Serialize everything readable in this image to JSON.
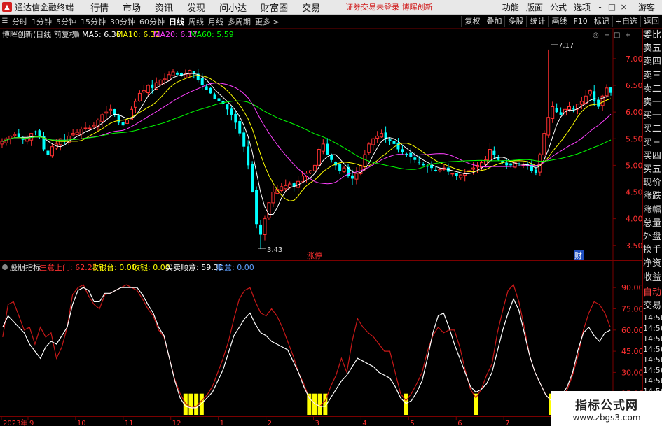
{
  "titlebar": {
    "app_name": "通达信金融终端",
    "logo_glyph": "▲",
    "menus": [
      "行情",
      "市场",
      "资讯",
      "发现",
      "问小达",
      "财富圈",
      "交易"
    ],
    "promo": "证券交易未登录  博晖创新",
    "right_menus": [
      "功能",
      "版面",
      "公式",
      "选项"
    ],
    "login": "游客",
    "window_buttons": [
      "-",
      "□",
      "×"
    ]
  },
  "toolbar": {
    "periods": [
      "分时",
      "1分钟",
      "5分钟",
      "15分钟",
      "30分钟",
      "60分钟",
      "日线",
      "周线",
      "月线",
      "多周期",
      "更多 >"
    ],
    "active_period": "日线",
    "buttons": [
      "复权",
      "叠加",
      "多股",
      "统计",
      "画线",
      "F10",
      "标记",
      "+自选",
      "返回"
    ]
  },
  "main_chart": {
    "header_title": "博晖创新(日线 前复权)",
    "ma_labels": [
      {
        "text": "MA5: 6.36",
        "color": "#ffffff"
      },
      {
        "text": "MA10: 6.31",
        "color": "#ffff00"
      },
      {
        "text": "MA20: 6.17",
        "color": "#ff40ff"
      },
      {
        "text": "MA60: 5.59",
        "color": "#00ff00"
      }
    ],
    "y_ticks": [
      "7.00",
      "6.50",
      "6.00",
      "5.50",
      "5.00",
      "4.50",
      "4.00",
      "3.50"
    ],
    "high_label": "7.17",
    "low_label": "3.43",
    "tag_zhangting": "涨停",
    "tag_cai": "财",
    "colors": {
      "up": "#ff3030",
      "down": "#00ffff",
      "ma5": "#ffffff",
      "ma10": "#ffff00",
      "ma20": "#ff40ff",
      "ma60": "#00ff00"
    }
  },
  "indicator": {
    "name": "股朋指标",
    "values": [
      {
        "text": "生意上门: 62.21",
        "color": "#ff3030"
      },
      {
        "text": "收银台: 0.00",
        "color": "#ffff00"
      },
      {
        "text": "收银: 0.00",
        "color": "#ffff00"
      },
      {
        "text": "买卖顺意: 59.31",
        "color": "#ffffff"
      },
      {
        "text": "顺意: 0.00",
        "color": "#5fa0ff"
      }
    ],
    "y_ticks": [
      "90.00",
      "75.00",
      "60.00",
      "45.00",
      "30.00",
      "15.00"
    ]
  },
  "date_axis": [
    "2023年",
    "9",
    "10",
    "11",
    "12",
    "1",
    "2",
    "3",
    "4",
    "5",
    "6",
    "7",
    "8",
    "9"
  ],
  "right_panel": {
    "items": [
      "委比",
      "卖五",
      "卖四",
      "卖三",
      "卖二",
      "卖一",
      "买一",
      "买二",
      "买三",
      "买四",
      "买五",
      "现价",
      "涨跌",
      "涨幅",
      "总量",
      "外盘",
      "换手",
      "净资",
      "收益"
    ],
    "label_auto": "自动",
    "label_trade": "交易",
    "times": [
      "14:56",
      "14:56",
      "14:56",
      "14:56",
      "14:56",
      "14:56",
      "14:56",
      "14:56",
      "14:56",
      "14:56"
    ]
  },
  "watermark": {
    "line1": "指标公式网",
    "line2": "www.zbgs3.com"
  },
  "chart_data": [
    {
      "type": "candlestick",
      "title": "博晖创新(日线 前复权)",
      "ylim": [
        3.3,
        7.3
      ],
      "closes": [
        5.45,
        5.5,
        5.55,
        5.58,
        5.52,
        5.48,
        5.5,
        5.6,
        5.62,
        5.55,
        5.3,
        5.2,
        5.35,
        5.4,
        5.5,
        5.45,
        5.55,
        5.6,
        5.62,
        5.68,
        5.7,
        5.7,
        5.75,
        5.85,
        5.95,
        6.0,
        6.05,
        5.95,
        5.8,
        5.75,
        5.85,
        6.05,
        6.2,
        6.35,
        6.4,
        6.5,
        6.45,
        6.55,
        6.6,
        6.62,
        6.7,
        6.75,
        6.7,
        6.68,
        6.72,
        6.78,
        6.72,
        6.6,
        6.5,
        6.42,
        6.35,
        6.25,
        6.2,
        6.15,
        6.05,
        5.95,
        5.8,
        5.6,
        5.35,
        5.0,
        4.5,
        3.9,
        3.7,
        4.0,
        4.3,
        4.5,
        4.55,
        4.6,
        4.62,
        4.65,
        4.6,
        4.7,
        4.8,
        4.85,
        4.9,
        5.0,
        5.3,
        5.4,
        5.2,
        5.1,
        5.0,
        4.9,
        4.95,
        4.8,
        4.75,
        4.85,
        5.0,
        5.2,
        5.4,
        5.5,
        5.55,
        5.6,
        5.5,
        5.45,
        5.4,
        5.3,
        5.25,
        5.2,
        5.15,
        5.1,
        5.05,
        5.0,
        4.98,
        4.95,
        4.9,
        4.92,
        4.95,
        4.88,
        4.85,
        4.8,
        4.82,
        4.85,
        4.9,
        4.95,
        5.0,
        5.05,
        5.1,
        5.3,
        5.2,
        5.1,
        5.05,
        5.0,
        5.0,
        5.05,
        5.02,
        5.0,
        4.98,
        4.9,
        4.85,
        5.2,
        5.6,
        5.9,
        6.1,
        6.0,
        5.95,
        6.05,
        6.1,
        6.05,
        6.15,
        6.2,
        6.3,
        6.4,
        6.2,
        6.1,
        6.3,
        6.45,
        6.36
      ],
      "ma_last": {
        "MA5": 6.36,
        "MA10": 6.31,
        "MA20": 6.17,
        "MA60": 5.59
      },
      "high": 7.17,
      "low": 3.43
    },
    {
      "type": "line",
      "title": "股朋指标",
      "ylim": [
        0,
        100
      ],
      "series": [
        {
          "name": "生意上门",
          "values": [
            55,
            78,
            80,
            70,
            60,
            62,
            50,
            62,
            55,
            58,
            40,
            48,
            62,
            85,
            90,
            92,
            84,
            78,
            75,
            85,
            86,
            88,
            90,
            92,
            90,
            88,
            82,
            75,
            70,
            60,
            55,
            40,
            25,
            15,
            8,
            5,
            6,
            10,
            14,
            20,
            30,
            40,
            52,
            68,
            82,
            88,
            90,
            80,
            72,
            70,
            75,
            70,
            62,
            52,
            42,
            30,
            22,
            12,
            8,
            6,
            10,
            20,
            28,
            40,
            30,
            52,
            68,
            62,
            58,
            55,
            50,
            45,
            45,
            30,
            15,
            10,
            15,
            22,
            30,
            45,
            56,
            62,
            58,
            60,
            60,
            48,
            32,
            18,
            12,
            18,
            28,
            36,
            58,
            74,
            88,
            92,
            80,
            62,
            42,
            30,
            22,
            14,
            10,
            8,
            12,
            18,
            28,
            42,
            60,
            72,
            80,
            78,
            72,
            62
          ]
        },
        {
          "name": "买卖顺意",
          "values": [
            62,
            70,
            66,
            62,
            58,
            50,
            45,
            40,
            48,
            52,
            50,
            56,
            62,
            78,
            88,
            90,
            88,
            80,
            80,
            86,
            86,
            88,
            90,
            90,
            90,
            90,
            85,
            78,
            72,
            62,
            56,
            40,
            24,
            12,
            6,
            5,
            5,
            8,
            12,
            16,
            24,
            32,
            44,
            56,
            62,
            68,
            72,
            64,
            58,
            56,
            52,
            50,
            48,
            46,
            38,
            30,
            20,
            12,
            8,
            6,
            6,
            12,
            18,
            24,
            28,
            34,
            40,
            38,
            36,
            34,
            30,
            28,
            26,
            20,
            12,
            8,
            10,
            16,
            24,
            40,
            58,
            70,
            72,
            62,
            50,
            40,
            30,
            20,
            16,
            18,
            22,
            30,
            45,
            60,
            72,
            82,
            74,
            58,
            42,
            30,
            22,
            14,
            10,
            8,
            14,
            20,
            30,
            46,
            58,
            62,
            56,
            52,
            58,
            60
          ]
        }
      ]
    }
  ]
}
